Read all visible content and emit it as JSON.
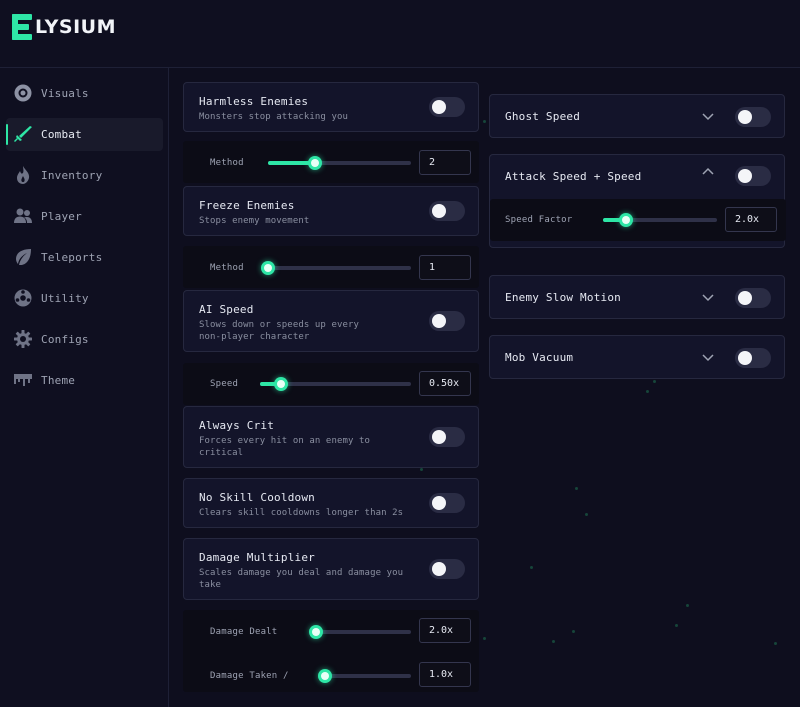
{
  "app": {
    "logo_text": "LYSIUM",
    "accent_color": "#2ee6a6"
  },
  "sidebar": {
    "items": [
      {
        "label": "Visuals",
        "icon": "eye-icon",
        "active": false
      },
      {
        "label": "Combat",
        "icon": "sword-icon",
        "active": true
      },
      {
        "label": "Inventory",
        "icon": "flame-icon",
        "active": false
      },
      {
        "label": "Player",
        "icon": "users-icon",
        "active": false
      },
      {
        "label": "Teleports",
        "icon": "leaf-icon",
        "active": false
      },
      {
        "label": "Utility",
        "icon": "ball-icon",
        "active": false
      },
      {
        "label": "Configs",
        "icon": "gear-icon",
        "active": false
      },
      {
        "label": "Theme",
        "icon": "paint-drip-icon",
        "active": false
      }
    ]
  },
  "left": {
    "harmless": {
      "title": "Harmless Enemies",
      "desc": "Monsters stop attacking you",
      "enabled": false,
      "slider": {
        "label": "Method",
        "value": "2",
        "fraction": 0.33
      }
    },
    "freeze": {
      "title": "Freeze Enemies",
      "desc": "Stops enemy movement",
      "enabled": false,
      "slider": {
        "label": "Method",
        "value": "1",
        "fraction": 0.0
      }
    },
    "ai_speed": {
      "title": "AI Speed",
      "desc_1": "Slows down or speeds up every",
      "desc_2": "non-player character",
      "enabled": false,
      "slider": {
        "label": "Speed",
        "value": "0.50x",
        "fraction": 0.14
      }
    },
    "always_crit": {
      "title": "Always Crit",
      "desc_1": "Forces every hit on an enemy to",
      "desc_2": "critical",
      "enabled": false
    },
    "no_cooldown": {
      "title": "No Skill Cooldown",
      "desc": "Clears skill cooldowns longer than 2s",
      "enabled": false
    },
    "damage_mult": {
      "title": "Damage Multiplier",
      "desc_1": "Scales damage you deal and damage you",
      "desc_2": "take",
      "enabled": false,
      "dealt": {
        "label": "Damage Dealt",
        "value": "2.0x",
        "fraction": 0.0
      },
      "taken": {
        "label": "Damage Taken /",
        "value": "1.0x",
        "fraction": 0.0
      }
    }
  },
  "right": {
    "ghost_speed": {
      "title": "Ghost Speed",
      "enabled": false,
      "expanded": false
    },
    "attack_speed": {
      "title": "Attack Speed + Speed",
      "enabled": false,
      "expanded": true,
      "slider": {
        "label": "Speed Factor",
        "value": "2.0x",
        "fraction": 0.2
      }
    },
    "enemy_slow": {
      "title": "Enemy Slow Motion",
      "enabled": false,
      "expanded": false
    },
    "mob_vacuum": {
      "title": "Mob Vacuum",
      "enabled": false,
      "expanded": false
    }
  }
}
